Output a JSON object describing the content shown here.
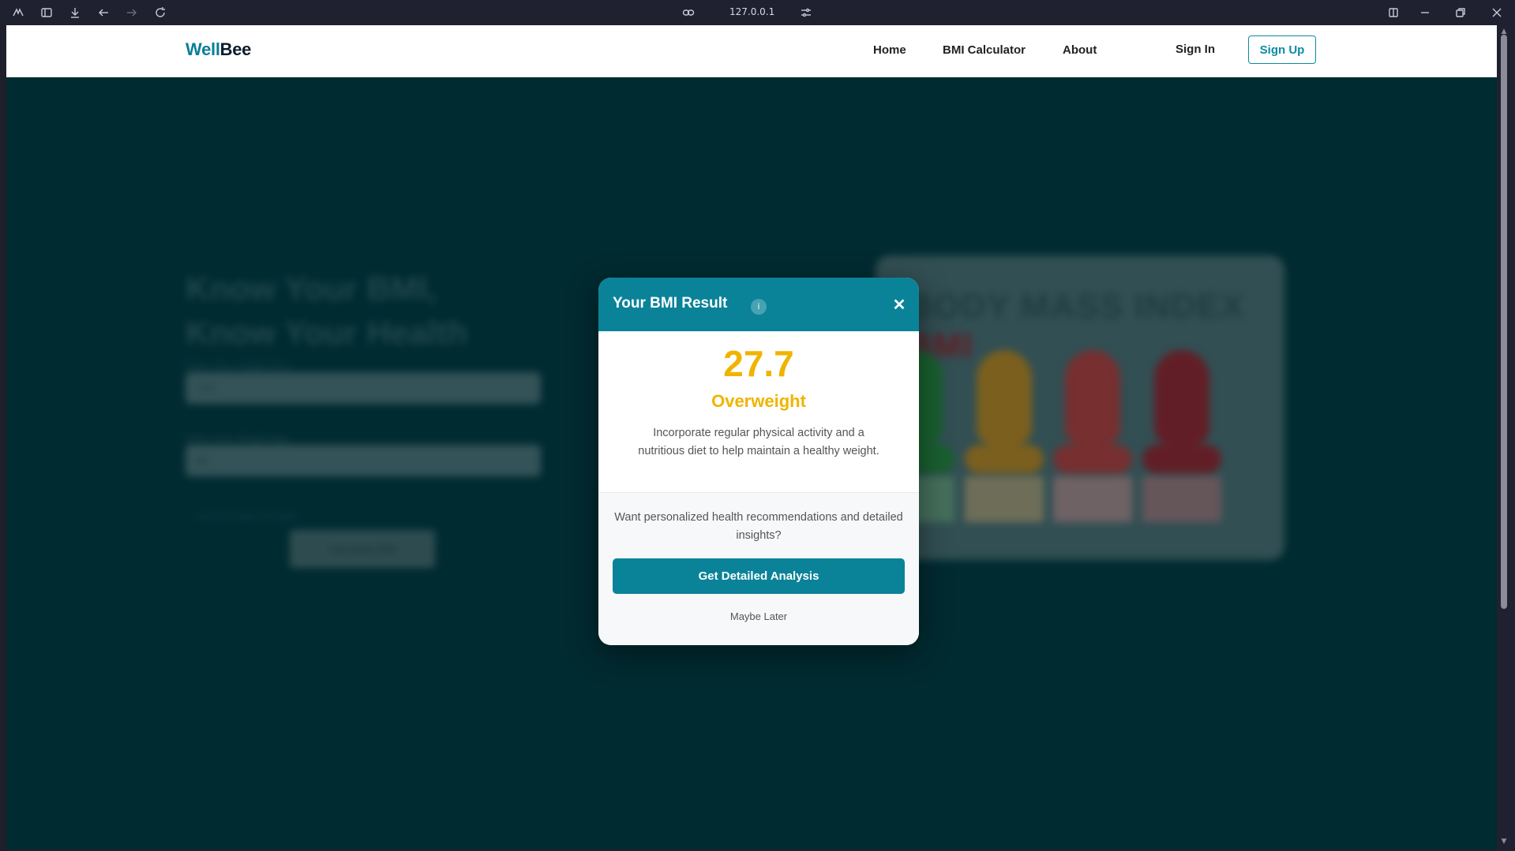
{
  "browser": {
    "url": "127.0.0.1",
    "icons": [
      "app-menu-icon",
      "sidebar-toggle-icon",
      "download-icon",
      "back-icon",
      "forward-icon",
      "reload-icon",
      "link-icon",
      "site-settings-icon",
      "split-view-icon",
      "minimize-icon",
      "restore-icon",
      "close-window-icon"
    ]
  },
  "navbar": {
    "logo_part1": "Well",
    "logo_part2": "Bee",
    "links": [
      "Home",
      "BMI Calculator",
      "About"
    ],
    "sign_in": "Sign In",
    "sign_up": "Sign Up"
  },
  "background": {
    "hero_title_line1": "Know Your BMI,",
    "hero_title_line2": "Know Your Health",
    "height_label": "Enter Your Height (cm)",
    "height_value": "170",
    "weight_label": "Enter Your Weight (kg)",
    "weight_value": "80",
    "hint": "* Input your height and weight",
    "calculate_button": "Calculate BMI",
    "bmi_card_title_prefix": "BODY MASS INDEX",
    "bmi_card_title_suffix": "BMI",
    "colors": [
      "#2e8b2e",
      "#e08a10",
      "#d9332f",
      "#b3151e"
    ]
  },
  "modal": {
    "title": "Your BMI Result",
    "bmi_value": "27.7",
    "category": "Overweight",
    "advice": "Incorporate regular physical activity and a nutritious diet to help maintain a healthy weight.",
    "cta_text": "Want personalized health recommendations and detailed insights?",
    "cta_button": "Get Detailed Analysis",
    "dismiss": "Maybe Later",
    "accent_color": "#0a8399",
    "result_color": "#f0b400"
  }
}
